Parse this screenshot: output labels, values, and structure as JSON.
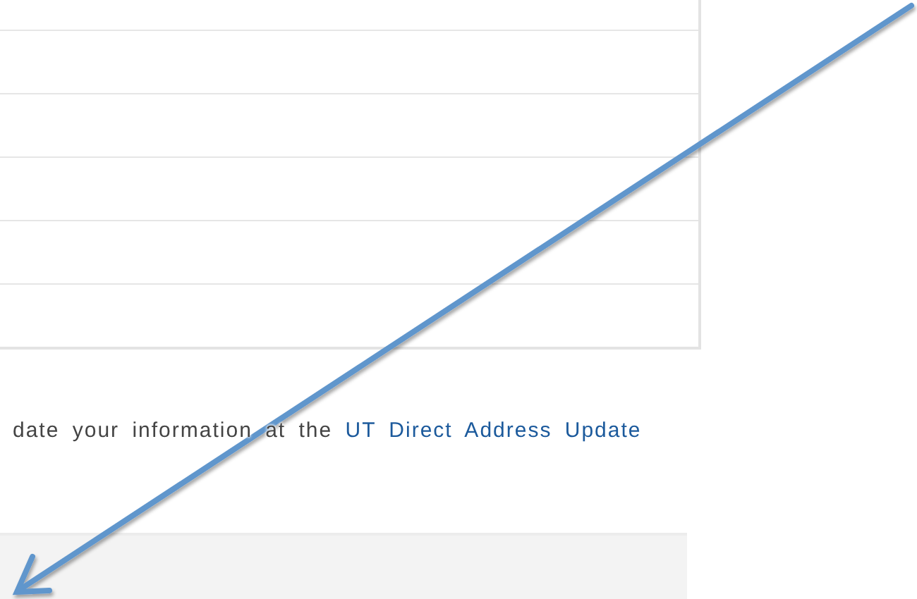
{
  "note": {
    "text": "date your information at the",
    "link": "UT Direct Address Update"
  }
}
